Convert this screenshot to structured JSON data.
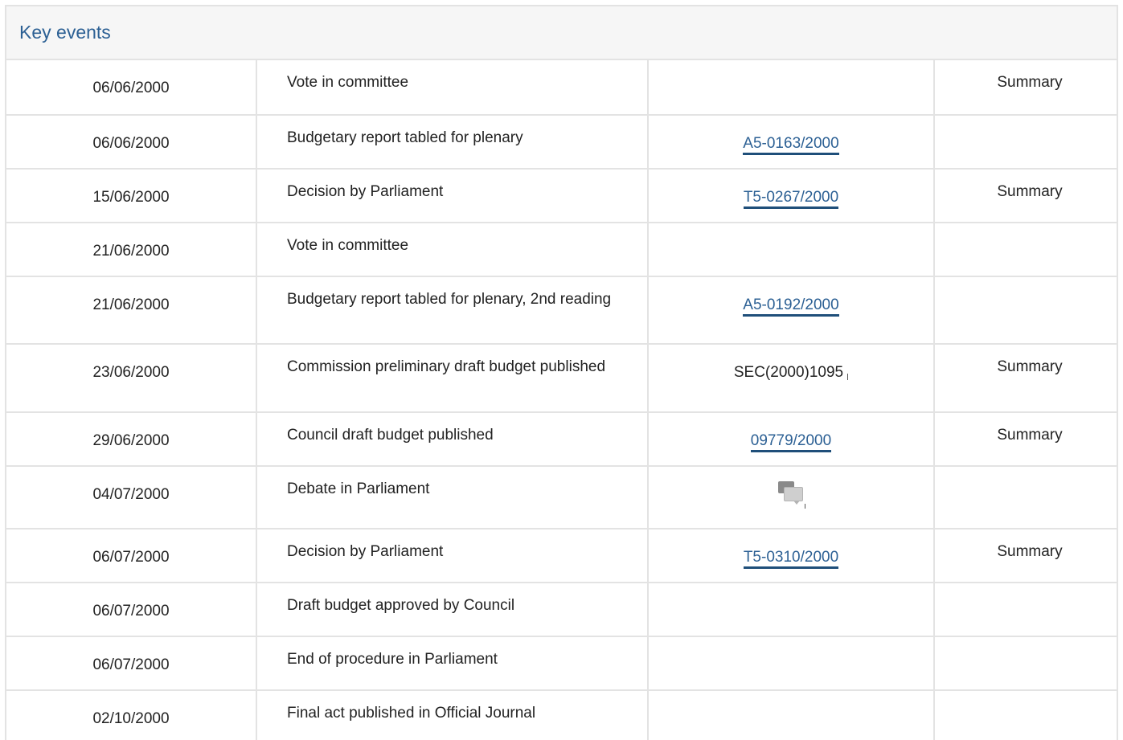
{
  "panel": {
    "title": "Key events"
  },
  "events": [
    {
      "date": "06/06/2000",
      "event": "Vote in committee",
      "doc": "",
      "doc_type": "none",
      "summary": "Summary"
    },
    {
      "date": "06/06/2000",
      "event": "Budgetary report tabled for plenary",
      "doc": "A5-0163/2000",
      "doc_type": "link",
      "summary": ""
    },
    {
      "date": "15/06/2000",
      "event": "Decision by Parliament",
      "doc": "T5-0267/2000",
      "doc_type": "link",
      "summary": "Summary"
    },
    {
      "date": "21/06/2000",
      "event": "Vote in committee",
      "doc": "",
      "doc_type": "none",
      "summary": ""
    },
    {
      "date": "21/06/2000",
      "event": "Budgetary report tabled for plenary, 2nd reading",
      "doc": "A5-0192/2000",
      "doc_type": "link",
      "summary": ""
    },
    {
      "date": "23/06/2000",
      "event": "Commission preliminary draft budget published",
      "doc": "SEC(2000)1095",
      "doc_type": "text",
      "summary": "Summary"
    },
    {
      "date": "29/06/2000",
      "event": "Council draft budget published",
      "doc": "09779/2000",
      "doc_type": "link",
      "summary": "Summary"
    },
    {
      "date": "04/07/2000",
      "event": "Debate in Parliament",
      "doc": "",
      "doc_type": "icon",
      "icon": "debate-icon",
      "summary": ""
    },
    {
      "date": "06/07/2000",
      "event": "Decision by Parliament",
      "doc": "T5-0310/2000",
      "doc_type": "link",
      "summary": "Summary"
    },
    {
      "date": "06/07/2000",
      "event": "Draft budget approved by Council",
      "doc": "",
      "doc_type": "none",
      "summary": ""
    },
    {
      "date": "06/07/2000",
      "event": "End of procedure in Parliament",
      "doc": "",
      "doc_type": "none",
      "summary": ""
    },
    {
      "date": "02/10/2000",
      "event": "Final act published in Official Journal",
      "doc": "",
      "doc_type": "none",
      "summary": ""
    }
  ],
  "colors": {
    "link": "#2c6094",
    "border": "#e3e3e3",
    "header_bg": "#f6f6f6"
  }
}
